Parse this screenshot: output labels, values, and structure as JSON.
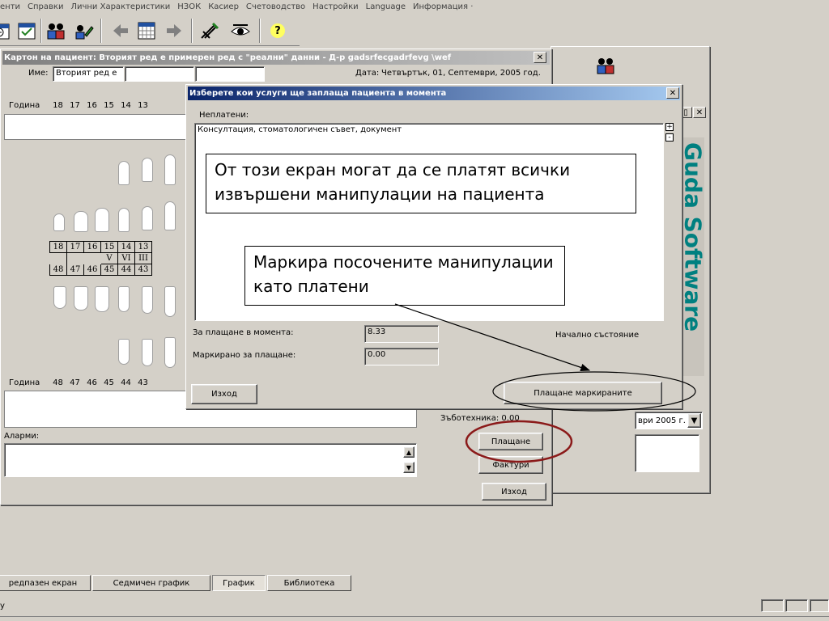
{
  "menu": [
    "енти",
    "Справки",
    "Лични Характеристики",
    "НЗОК",
    "Касиер",
    "Счетоводство",
    "Настройки",
    "Language",
    "Информация ·"
  ],
  "toolbar": {
    "icons": [
      "calendar-icon",
      "patients-icon",
      "patient-edit-icon",
      "back-arrow-icon",
      "grid-calendar-icon",
      "forward-arrow-icon",
      "tools-icon",
      "eye-icon",
      "help-icon"
    ],
    "help_glyph": "?"
  },
  "card": {
    "title": "Картон на пациент: Вторият ред е примерен ред с \"реални\" данни  - Д-р gadsrfecgadrfevg \\wef",
    "close": "✕",
    "name_label": "Име:",
    "name_value": "Вторият ред е",
    "date_label": "Дата:",
    "date_value": "Четвъртък, 01, Септември, 2005 год.",
    "year_label": "Година",
    "upper_teeth": [
      "18",
      "17",
      "16",
      "15",
      "14",
      "13"
    ],
    "lower_teeth": [
      "48",
      "47",
      "46",
      "45",
      "44",
      "43"
    ],
    "roman_row": [
      "",
      "",
      "",
      "V",
      "VI",
      "III"
    ],
    "year_label_bottom": "Година",
    "alarms_label": "Аларми:",
    "dental_tech": "Зъботехника: 0.00",
    "date_combo": "ври 2005 г.",
    "pay_button": "Плащане",
    "invoices_button": "Фактури",
    "exit_button": "Изход"
  },
  "dialog": {
    "title": "Изберете кои услуги ще заплаща пациента в момента",
    "close": "✕",
    "unpaid_label": "Неплатени:",
    "unpaid_item": "Консултация, стоматологичен съвет, документ",
    "pay_now_label": "За плащане в момента:",
    "pay_now_value": "8.33",
    "marked_label": "Маркирано за плащане:",
    "marked_value": "0.00",
    "initial_state": "Начално състояние",
    "exit_button": "Изход",
    "pay_marked_button": "Плащане маркираните",
    "plus": "+",
    "minus": "-"
  },
  "callouts": {
    "top": "От този екран могат да се платят всички извършени манипулации на пациента",
    "middle": "Маркира посочените манипулации като платени"
  },
  "brand": "Guda Software",
  "tabs": [
    "редпазен екран",
    "Седмичен график",
    "График",
    "Библиотека"
  ],
  "active_tab": "График",
  "status": "у",
  "colors": {
    "face": "#d4d0c8",
    "title_active": "#0a246a",
    "brand_teal": "#008080",
    "ring_red": "#8b1a1a"
  }
}
